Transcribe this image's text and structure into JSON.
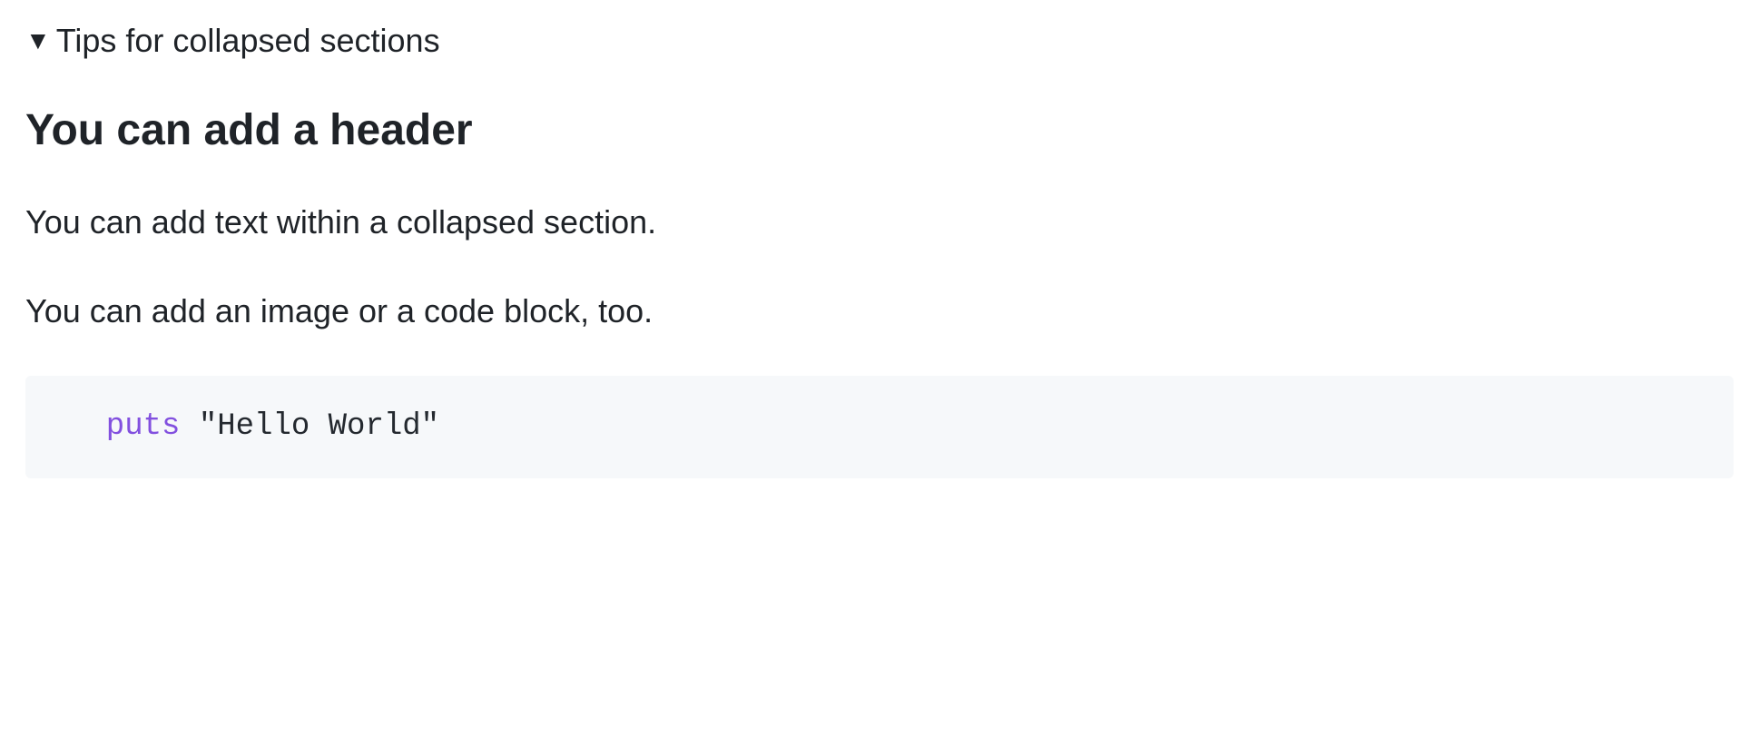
{
  "summary": {
    "label": "Tips for collapsed sections"
  },
  "content": {
    "heading": "You can add a header",
    "paragraph1": "You can add text within a collapsed section.",
    "paragraph2": "You can add an image or a code block, too."
  },
  "code": {
    "keyword": "puts",
    "space": " ",
    "string": "\"Hello World\""
  }
}
